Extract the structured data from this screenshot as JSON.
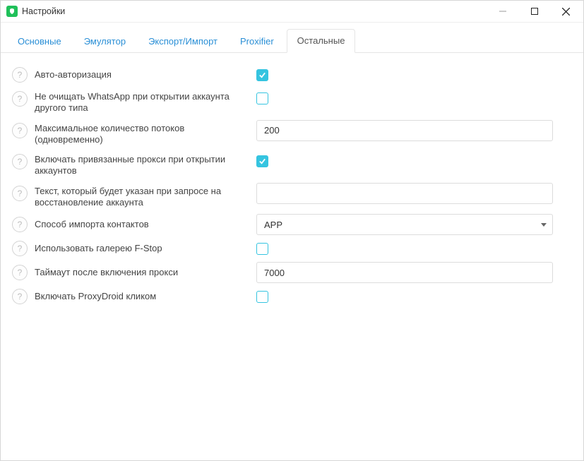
{
  "window": {
    "title": "Настройки"
  },
  "tabs": [
    {
      "label": "Основные"
    },
    {
      "label": "Эмулятор"
    },
    {
      "label": "Экспорт/Импорт"
    },
    {
      "label": "Proxifier"
    },
    {
      "label": "Остальные"
    }
  ],
  "rows": {
    "auto_auth": {
      "label": "Авто-авторизация",
      "checked": true
    },
    "keep_whatsapp": {
      "label": "Не очищать WhatsApp при открытии аккаунта другого типа",
      "checked": false
    },
    "max_threads": {
      "label": "Максимальное количество потоков (одновременно)",
      "value": "200"
    },
    "enable_proxy_on_open": {
      "label": "Включать привязанные прокси при открытии аккаунтов",
      "checked": true
    },
    "recovery_text": {
      "label": "Текст, который будет указан при запросе на восстановление аккаунта",
      "value": ""
    },
    "import_method": {
      "label": "Способ импорта контактов",
      "value": "APP"
    },
    "use_fstop": {
      "label": "Использовать галерею F-Stop",
      "checked": false
    },
    "proxy_timeout": {
      "label": "Таймаут после включения прокси",
      "value": "7000"
    },
    "proxydroid_click": {
      "label": "Включать ProxyDroid кликом",
      "checked": false
    }
  }
}
